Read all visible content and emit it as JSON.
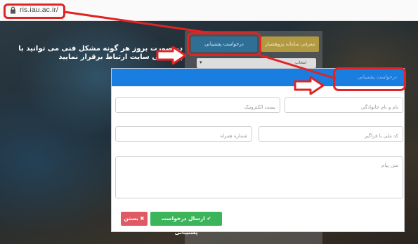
{
  "browser": {
    "url": "ris.iau.ac.ir/"
  },
  "annotation": {
    "help_text": "در صورت بروز هر گونه مشکل فنی می توانید با پشتیبانی سایت ارتباط برقرار نمایید",
    "highlight_color": "#e02424"
  },
  "background_page": {
    "researcher_button": "معرفی سامانه پژوهشیار",
    "support_request_button": "درخواست پشتیبانی",
    "select_text": "انتخاب"
  },
  "modal": {
    "header_title": "درخواست پشتیبانی",
    "header_color": "#1a7de0",
    "fields": {
      "full_name": "نام و نام خانوادگی",
      "email": "پست الکترونیک",
      "national_code": "کد ملی یا فراگیر",
      "mobile": "شماره همراه",
      "message": "متن پیام"
    },
    "send_button": "ارسال درخواست پشتیبانی",
    "close_button": "بستن",
    "send_color": "#3bb45a",
    "close_color": "#e05a63"
  }
}
